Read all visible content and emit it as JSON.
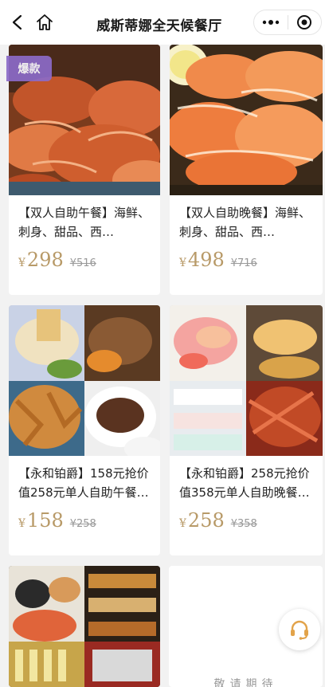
{
  "navbar": {
    "title": "威斯蒂娜全天候餐厅"
  },
  "badge": "爆款",
  "products": [
    {
      "name": "【双人自助午餐】海鲜、刺身、甜品、西…",
      "currency": "¥",
      "price": "298",
      "original": "¥516"
    },
    {
      "name": "【双人自助晚餐】海鲜、刺身、甜品、西…",
      "currency": "¥",
      "price": "498",
      "original": "¥716"
    },
    {
      "name": "【永和铂爵】158元抢价值258元单人自助午餐…",
      "currency": "¥",
      "price": "158",
      "original": "¥258"
    },
    {
      "name": "【永和铂爵】258元抢价值358元单人自助晚餐…",
      "currency": "¥",
      "price": "258",
      "original": "¥358"
    },
    {
      "name": "",
      "currency": "",
      "price": "",
      "original": ""
    }
  ],
  "coming_soon": "敬请期待",
  "colors": {
    "price": "#b89a68",
    "badge": "#8c6bc8",
    "background": "#f2f2f2"
  },
  "icons": {
    "back": "chevron-left-icon",
    "home": "home-icon",
    "more": "more-dots-icon",
    "close": "miniprogram-close-icon",
    "customer_service": "headset-icon"
  }
}
